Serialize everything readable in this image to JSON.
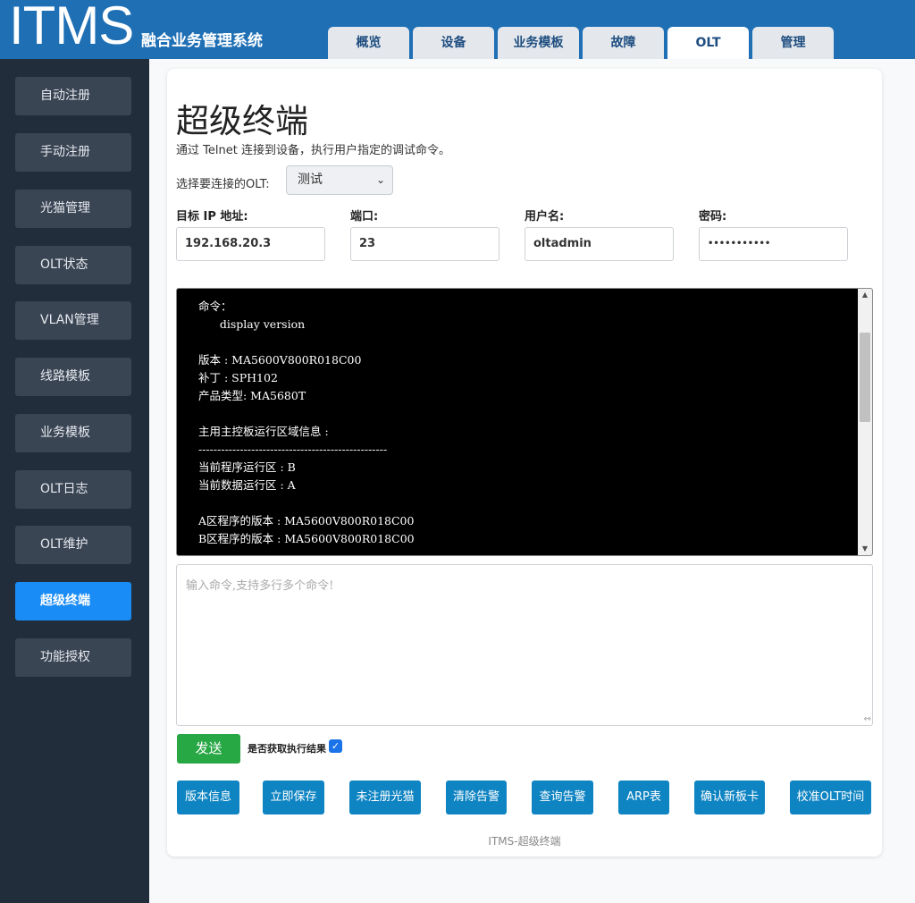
{
  "header": {
    "logo": "ITMS",
    "subtitle": "融合业务管理系统",
    "tabs": [
      {
        "label": "概览"
      },
      {
        "label": "设备"
      },
      {
        "label": "业务模板"
      },
      {
        "label": "故障"
      },
      {
        "label": "OLT",
        "active": true
      },
      {
        "label": "管理"
      }
    ]
  },
  "sidebar": {
    "items": [
      {
        "label": "自动注册"
      },
      {
        "label": "手动注册"
      },
      {
        "label": "光猫管理"
      },
      {
        "label": "OLT状态"
      },
      {
        "label": "VLAN管理"
      },
      {
        "label": "线路模板"
      },
      {
        "label": "业务模板"
      },
      {
        "label": "OLT日志"
      },
      {
        "label": "OLT维护"
      },
      {
        "label": "超级终端",
        "active": true
      },
      {
        "label": "功能授权"
      }
    ]
  },
  "main": {
    "title": "超级终端",
    "description": "通过 Telnet 连接到设备，执行用户指定的调试命令。",
    "olt_select_label": "选择要连接的OLT:",
    "olt_select_value": "测试",
    "fields": {
      "ip": {
        "label": "目标 IP 地址:",
        "value": "192.168.20.3"
      },
      "port": {
        "label": "端口:",
        "value": "23"
      },
      "username": {
        "label": "用户名:",
        "value": "oltadmin"
      },
      "password": {
        "label": "密码:",
        "value": "•••••••••••"
      }
    },
    "terminal_output": "命令：\n      display version\n\n版本 : MA5600V800R018C00\n补丁 : SPH102\n产品类型: MA5680T\n\n主用主控板运行区域信息 :\n--------------------------------------------------\n当前程序运行区 : B\n当前数据运行区 : A\n\nA区程序的版本 : MA5600V800R018C00\nB区程序的版本 : MA5600V800R018C00",
    "command_placeholder": "输入命令,支持多行多个命令!",
    "send_label": "发送",
    "fetch_result_label": "是否获取执行结果",
    "fetch_result_checked": true,
    "actions": [
      {
        "label": "版本信息"
      },
      {
        "label": "立即保存"
      },
      {
        "label": "未注册光猫"
      },
      {
        "label": "清除告警"
      },
      {
        "label": "查询告警"
      },
      {
        "label": "ARP表"
      },
      {
        "label": "确认新板卡"
      },
      {
        "label": "校准OLT时间"
      }
    ],
    "footer": "ITMS-超级终端"
  },
  "colors": {
    "header_bg": "#1e6fb4",
    "sidebar_bg": "#212d3b",
    "sidebar_active": "#1a8cf5",
    "send_button": "#28a745",
    "action_button": "#0f84c2"
  }
}
